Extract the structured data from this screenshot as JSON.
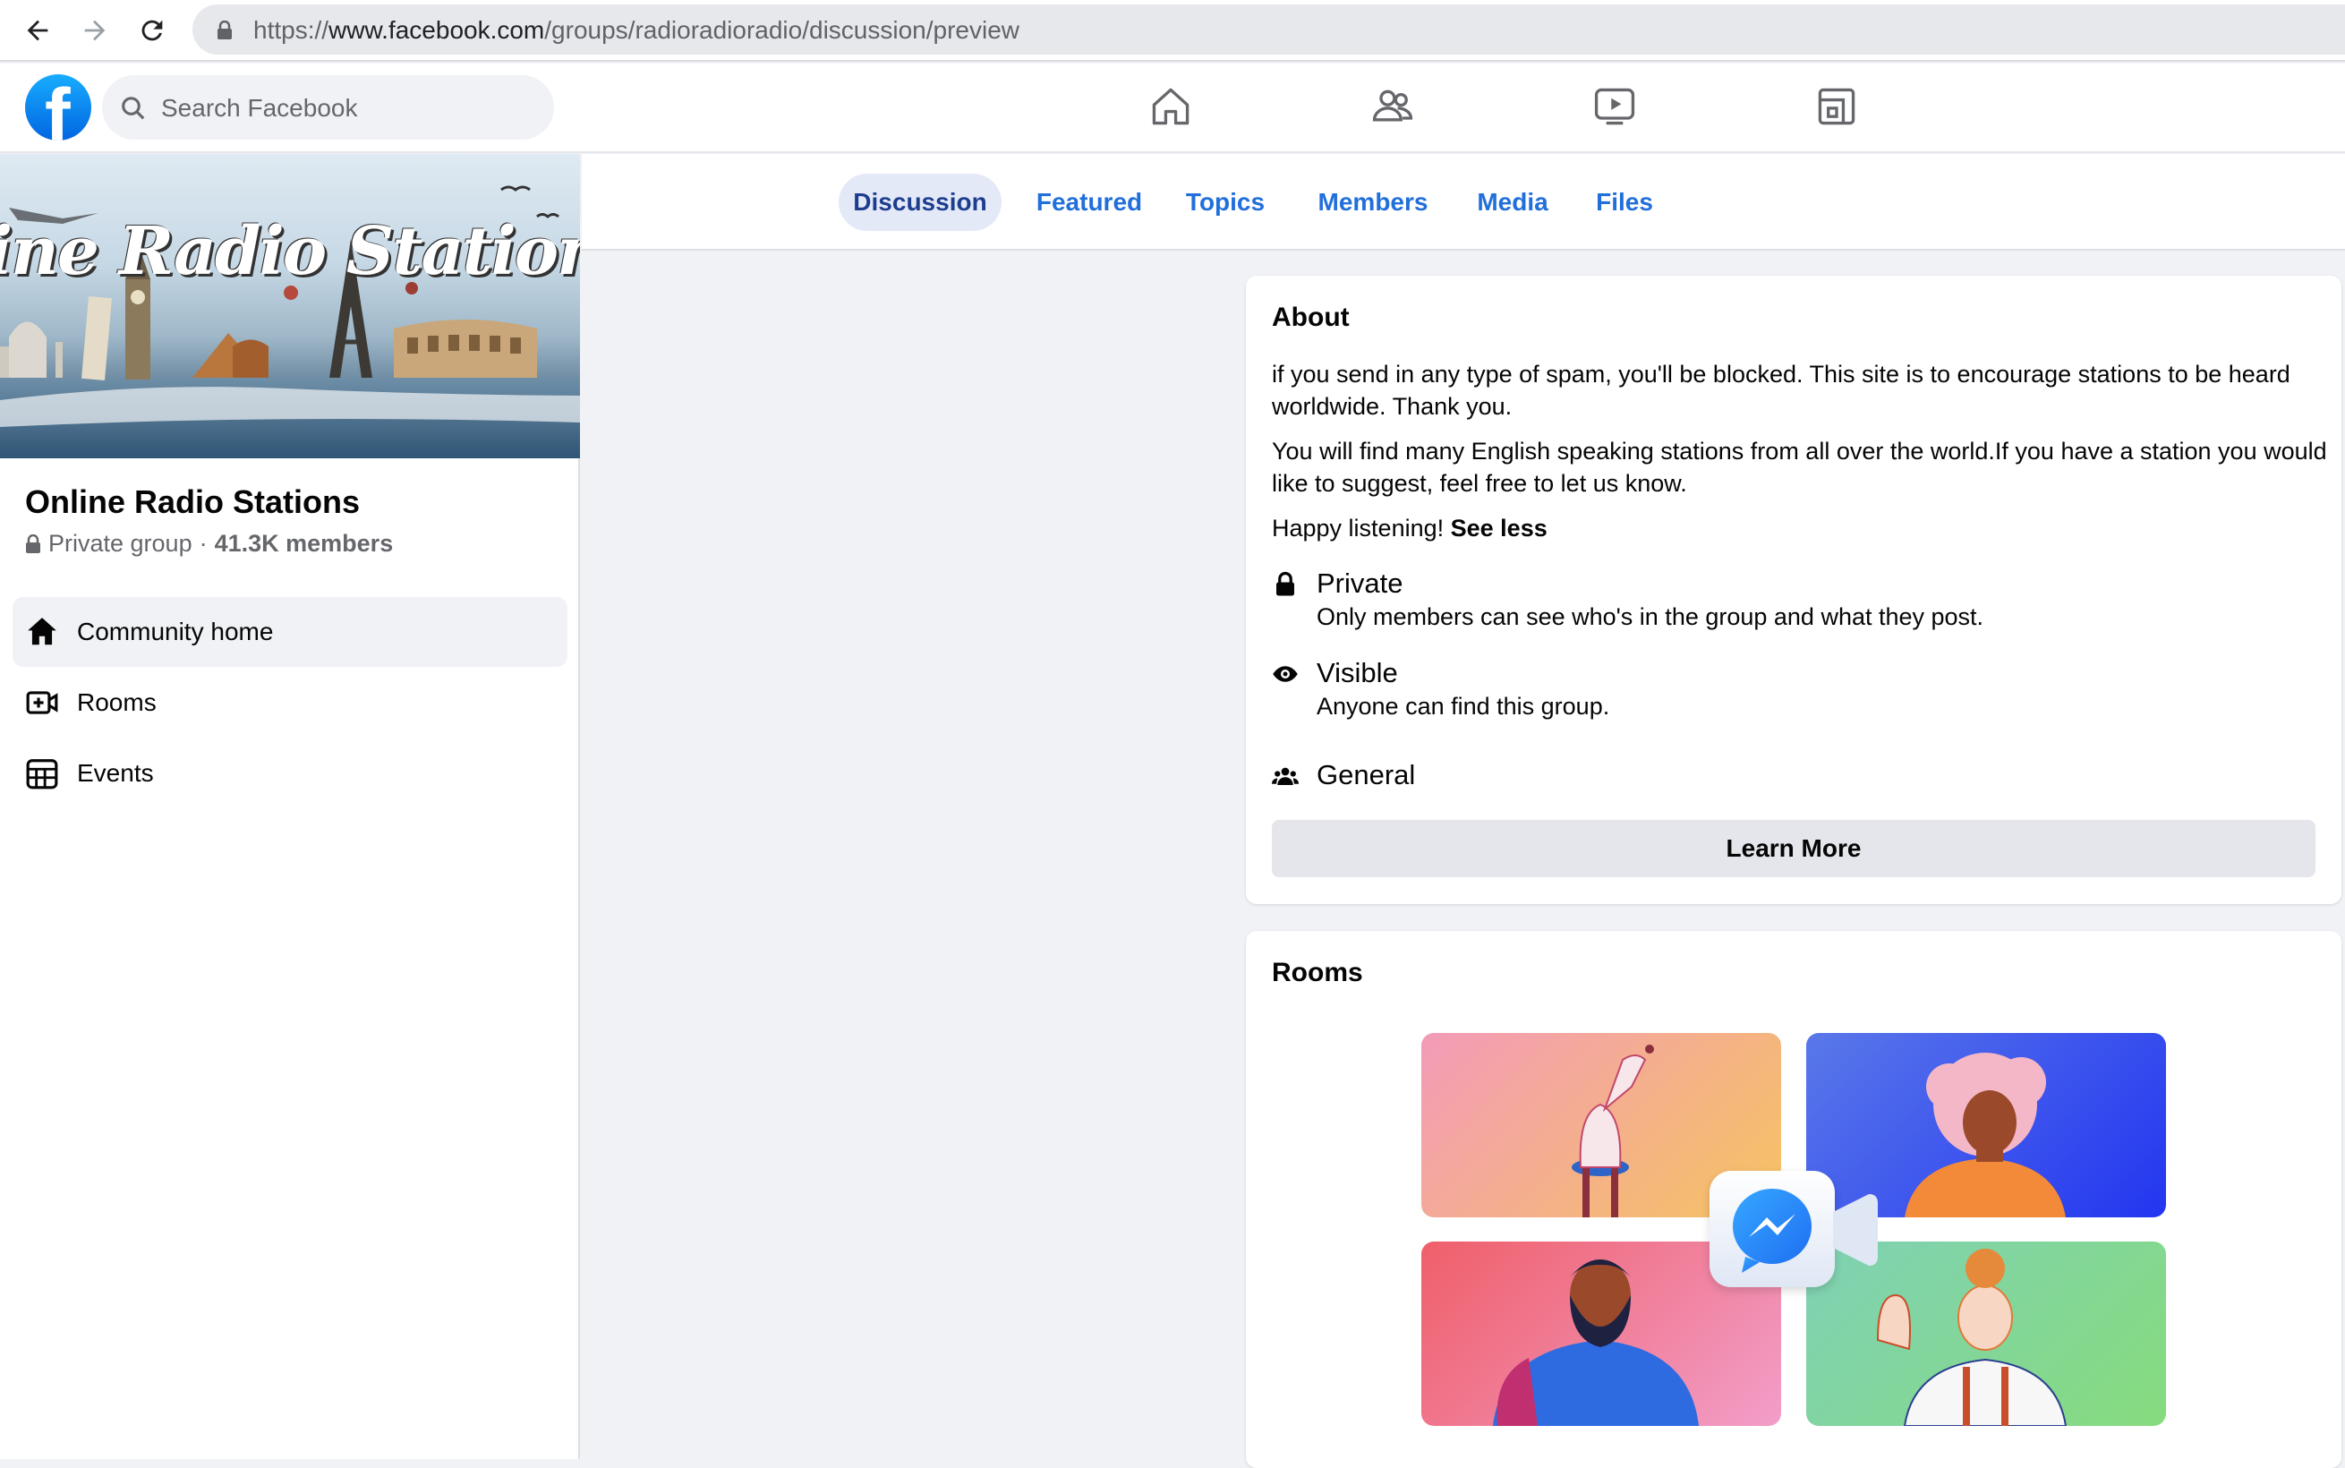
{
  "browser": {
    "url_prefix": "https://",
    "url_domain": "www.facebook.com",
    "url_path": "/groups/radioradioradio/discussion/preview"
  },
  "header": {
    "logo_glyph": "f",
    "search_placeholder": "Search Facebook",
    "nav_icons": [
      "home-icon",
      "friends-icon",
      "watch-icon",
      "gaming-icon"
    ]
  },
  "group": {
    "cover_text": "ine Radio Stations of the Wor",
    "name": "Online Radio Stations",
    "privacy": "Private group",
    "separator": "·",
    "members": "41.3K members"
  },
  "sidebar": {
    "items": [
      {
        "label": "Community home",
        "icon": "home-icon",
        "active": true
      },
      {
        "label": "Rooms",
        "icon": "video-add-icon",
        "active": false
      },
      {
        "label": "Events",
        "icon": "calendar-icon",
        "active": false
      }
    ]
  },
  "tabs": [
    {
      "label": "Discussion",
      "active": true
    },
    {
      "label": "Featured",
      "active": false
    },
    {
      "label": "Topics",
      "active": false
    },
    {
      "label": "Members",
      "active": false
    },
    {
      "label": "Media",
      "active": false
    },
    {
      "label": "Files",
      "active": false
    }
  ],
  "about": {
    "title": "About",
    "paragraph_1": "if you send in any type of spam, you'll be blocked. This site is to encourage stations to be heard worldwide. Thank you.",
    "paragraph_2": "You will find many English speaking stations from all over the world.If you have a station you would like to suggest, feel free to let us know.",
    "paragraph_3": "Happy listening!",
    "see_less": "See less",
    "privacy_title": "Private",
    "privacy_desc": "Only members can see who's in the group and what they post.",
    "visibility_title": "Visible",
    "visibility_desc": "Anyone can find this group.",
    "category": "General",
    "learn_more": "Learn More"
  },
  "rooms": {
    "title": "Rooms"
  },
  "colors": {
    "accent": "#216fdb",
    "tab_active_bg": "#e4e9f8",
    "page_bg": "#f0f2f5"
  }
}
